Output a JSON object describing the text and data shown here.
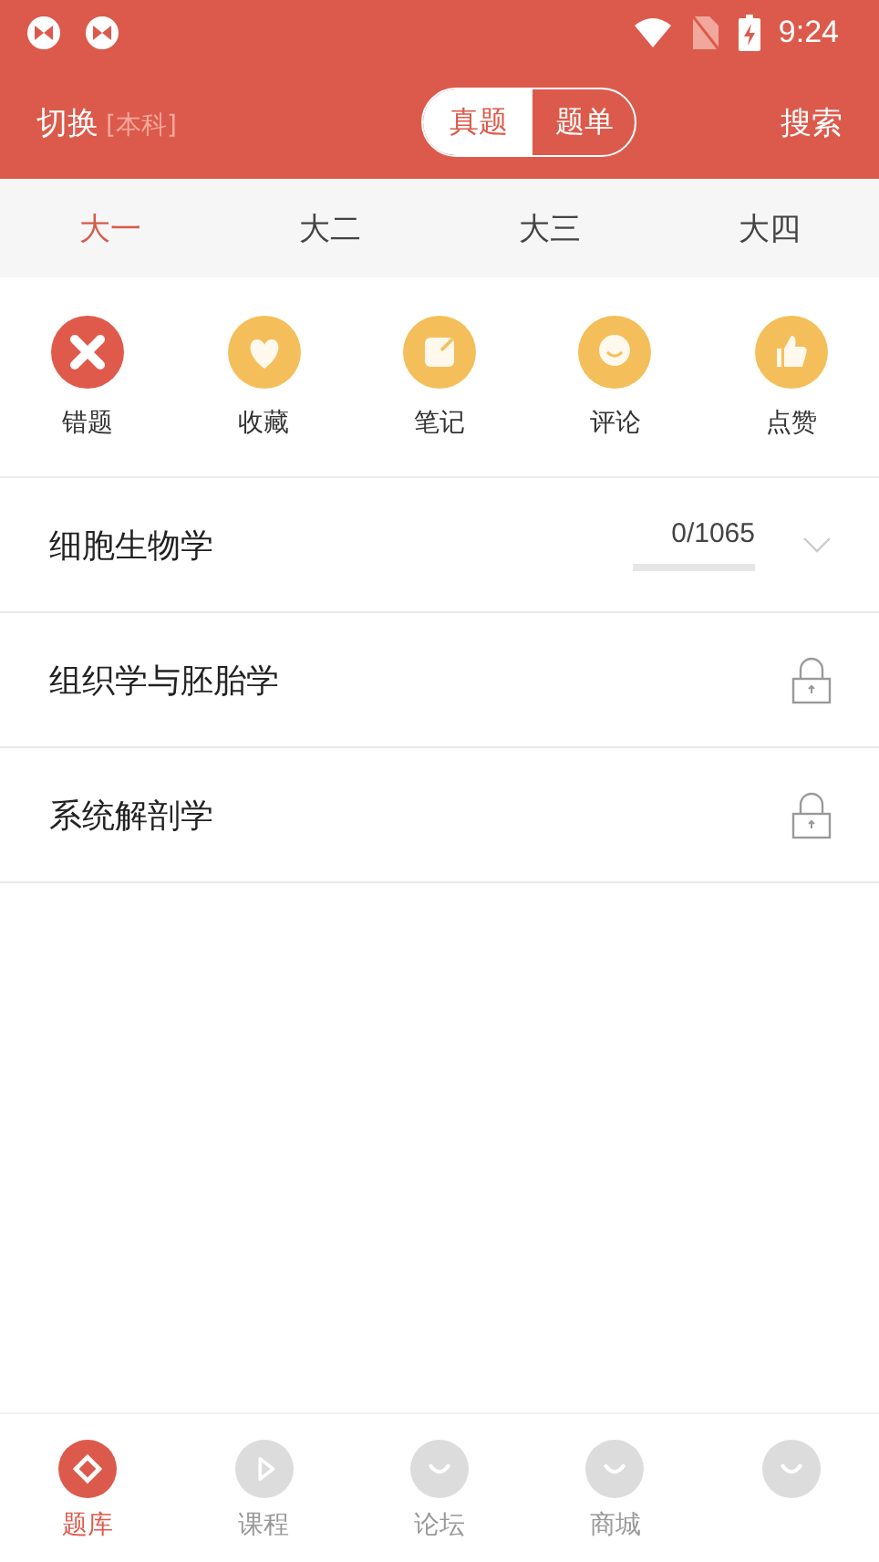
{
  "status_bar": {
    "time": "9:24"
  },
  "header": {
    "switch_label": "切换",
    "level": "[本科]",
    "segments": [
      {
        "label": "真题",
        "selected": true
      },
      {
        "label": "题单",
        "selected": false
      }
    ],
    "search": "搜索"
  },
  "year_tabs": [
    {
      "label": "大一",
      "selected": true
    },
    {
      "label": "大二",
      "selected": false
    },
    {
      "label": "大三",
      "selected": false
    },
    {
      "label": "大四",
      "selected": false
    }
  ],
  "shortcuts": [
    {
      "label": "错题",
      "kind": "cross",
      "color": "#e05a4c"
    },
    {
      "label": "收藏",
      "kind": "heart",
      "color": "#f4bf5a"
    },
    {
      "label": "笔记",
      "kind": "note",
      "color": "#f4bf5a"
    },
    {
      "label": "评论",
      "kind": "comment",
      "color": "#f4bf5a"
    },
    {
      "label": "点赞",
      "kind": "thumb",
      "color": "#f4bf5a"
    }
  ],
  "subjects": [
    {
      "name": "细胞生物学",
      "kind": "progress",
      "count": "0/1065",
      "level": 0
    },
    {
      "name": "组织学与胚胎学",
      "kind": "locked"
    },
    {
      "name": "系统解剖学",
      "kind": "locked"
    }
  ],
  "bottom_nav": [
    {
      "label": "题库",
      "kind": "bank",
      "selected": true
    },
    {
      "label": "课程",
      "kind": "play",
      "selected": false
    },
    {
      "label": "论坛",
      "kind": "smile",
      "selected": false
    },
    {
      "label": "商城",
      "kind": "smile",
      "selected": false
    },
    {
      "kind": "smile",
      "selected": false
    }
  ]
}
